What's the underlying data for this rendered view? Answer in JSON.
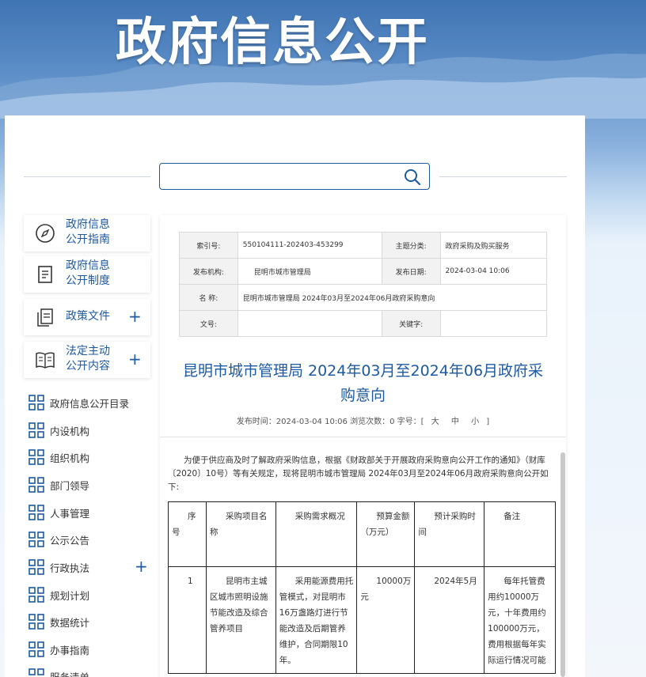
{
  "banner": {
    "title": "政府信息公开"
  },
  "search": {
    "placeholder": ""
  },
  "sidebar": {
    "cards": [
      {
        "line1": "政府信息",
        "line2": "公开指南",
        "icon": "compass-icon",
        "expandable": false
      },
      {
        "line1": "政府信息",
        "line2": "公开制度",
        "icon": "document-icon",
        "expandable": false
      },
      {
        "line1": "政策文件",
        "line2": "",
        "icon": "files-icon",
        "expandable": true
      },
      {
        "line1": "法定主动",
        "line2": "公开内容",
        "icon": "book-icon",
        "expandable": true
      }
    ],
    "items": [
      {
        "label": "政府信息公开目录",
        "expandable": false
      },
      {
        "label": "内设机构",
        "expandable": false
      },
      {
        "label": "组织机构",
        "expandable": false
      },
      {
        "label": "部门领导",
        "expandable": false
      },
      {
        "label": "人事管理",
        "expandable": false
      },
      {
        "label": "公示公告",
        "expandable": false
      },
      {
        "label": "行政执法",
        "expandable": true
      },
      {
        "label": "规划计划",
        "expandable": false
      },
      {
        "label": "数据统计",
        "expandable": false
      },
      {
        "label": "办事指南",
        "expandable": false
      },
      {
        "label": "服务清单",
        "expandable": false
      }
    ],
    "plus_symbol": "+"
  },
  "meta": {
    "index_label": "索引号:",
    "index_value": "550104111-202403-453299",
    "topic_label": "主题分类:",
    "topic_value": "政府采购及购买服务",
    "publisher_label": "发布机构:",
    "publisher_value": "昆明市城市管理局",
    "date_label": "发布日期:",
    "date_value": "2024-03-04 10:06",
    "name_label": "名    称:",
    "name_value": "昆明市城市管理局 2024年03月至2024年06月政府采购意向",
    "docno_label": "文号:",
    "docno_value": "",
    "keywords_label": "关键字:",
    "keywords_value": ""
  },
  "article": {
    "title": "昆明市城市管理局 2024年03月至2024年06月政府采购意向",
    "info_prefix": "发布时间：2024-03-04 10:06 浏览次数：0 字号：[",
    "font_large": "大",
    "font_medium": "中",
    "font_small": "小",
    "info_suffix": "]",
    "intro": "为便于供应商及时了解政府采购信息，根据《财政部关于开展政府采购意向公开工作的通知》（财库〔2020〕10号）等有关规定，现将昆明市城市管理局 2024年03月至2024年06月政府采购意向公开如下:"
  },
  "procurement_table": {
    "headers": [
      "序号",
      "采购项目名称",
      "采购需求概况",
      "预算金额（万元）",
      "预计采购时间",
      "备注"
    ],
    "rows": [
      {
        "no": "1",
        "name": "昆明市主城区城市照明设施节能改造及综合管养项目",
        "need": "采用能源费用托管模式，对昆明市16万盏路灯进行节能改造及后期管养维护，合同期限10年。",
        "budget": "10000万元",
        "time": "2024年5月",
        "note": "每年托管费用约10000万元，十年费用约100000万元，费用根据每年实际运行情况可能"
      }
    ]
  }
}
